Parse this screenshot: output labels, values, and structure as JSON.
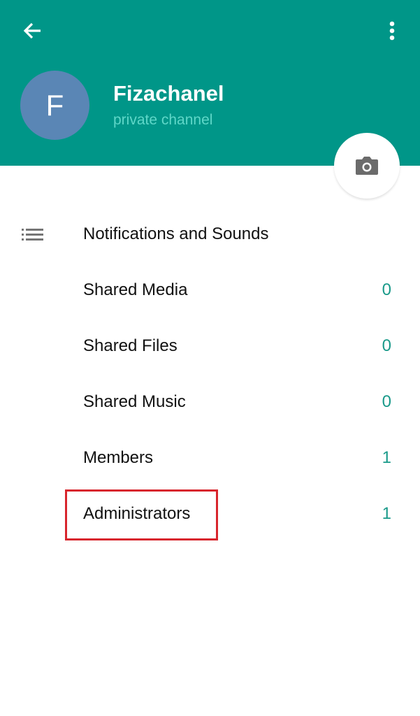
{
  "header": {
    "title": "Fizachanel",
    "subtitle": "private channel",
    "avatar_letter": "F",
    "color": "#009688",
    "avatar_color": "#5a86b5"
  },
  "icons": {
    "back": "arrow-left-icon",
    "more": "more-vertical-icon",
    "camera": "camera-icon",
    "list": "list-icon"
  },
  "items": [
    {
      "label": "Notifications and Sounds",
      "count": ""
    },
    {
      "label": "Shared Media",
      "count": "0"
    },
    {
      "label": "Shared Files",
      "count": "0"
    },
    {
      "label": "Shared Music",
      "count": "0"
    },
    {
      "label": "Members",
      "count": "1"
    },
    {
      "label": "Administrators",
      "count": "1"
    }
  ],
  "highlight_color": "#d8262d"
}
